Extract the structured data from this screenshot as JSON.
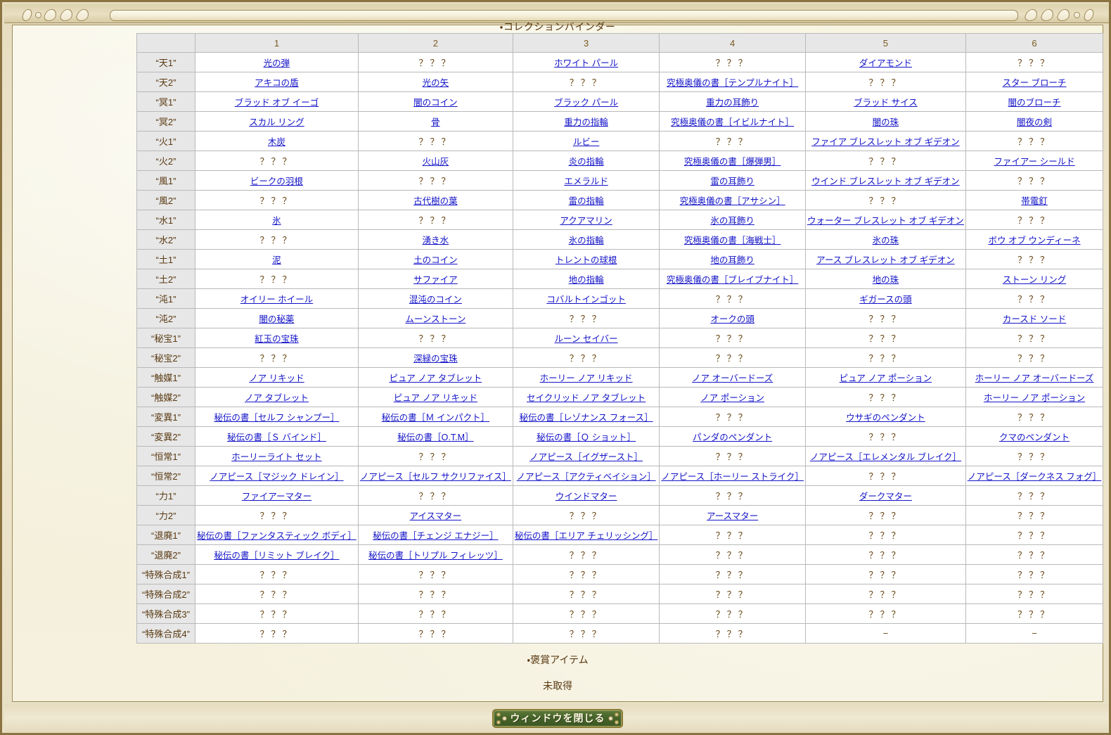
{
  "window": {
    "title": "・コレクションバインダー"
  },
  "table": {
    "corner_label": "",
    "columns": [
      "1",
      "2",
      "3",
      "4",
      "5",
      "6"
    ],
    "unknown_marker": "？？？",
    "dash_marker": "−",
    "rows": [
      {
        "label": "“天1”",
        "cells": [
          "光の弾",
          "？？？",
          "ホワイト パール",
          "？？？",
          "ダイアモンド",
          "？？？"
        ]
      },
      {
        "label": "“天2”",
        "cells": [
          "アキコの盾",
          "光の矢",
          "？？？",
          "究極奥儀の書［テンプルナイト］",
          "？？？",
          "スター ブローチ"
        ]
      },
      {
        "label": "“冥1”",
        "cells": [
          "ブラッド オブ イーゴ",
          "闇のコイン",
          "ブラック パール",
          "重力の耳飾り",
          "ブラッド サイス",
          "闇のブローチ"
        ]
      },
      {
        "label": "“冥2”",
        "cells": [
          "スカル リング",
          "骨",
          "重力の指輪",
          "究極奥儀の書［イビルナイト］",
          "闇の珠",
          "闇夜の剣"
        ]
      },
      {
        "label": "“火1”",
        "cells": [
          "木炭",
          "？？？",
          "ルビー",
          "？？？",
          "ファイア ブレスレット オブ ギデオン",
          "？？？"
        ]
      },
      {
        "label": "“火2”",
        "cells": [
          "？？？",
          "火山灰",
          "炎の指輪",
          "究極奥儀の書［爆弾男］",
          "？？？",
          "ファイアー シールド"
        ]
      },
      {
        "label": "“風1”",
        "cells": [
          "ビークの羽根",
          "？？？",
          "エメラルド",
          "雷の耳飾り",
          "ウインド ブレスレット オブ ギデオン",
          "？？？"
        ]
      },
      {
        "label": "“風2”",
        "cells": [
          "？？？",
          "古代樹の葉",
          "雷の指輪",
          "究極奥儀の書［アサシン］",
          "？？？",
          "帯電釘"
        ]
      },
      {
        "label": "“水1”",
        "cells": [
          "氷",
          "？？？",
          "アクアマリン",
          "氷の耳飾り",
          "ウォーター ブレスレット オブ ギデオン",
          "？？？"
        ]
      },
      {
        "label": "“水2”",
        "cells": [
          "？？？",
          "湧き水",
          "氷の指輪",
          "究極奥儀の書［海戦士］",
          "氷の珠",
          "ボウ オブ ウンディーネ"
        ]
      },
      {
        "label": "“土1”",
        "cells": [
          "泥",
          "土のコイン",
          "トレントの球根",
          "地の耳飾り",
          "アース ブレスレット オブ ギデオン",
          "？？？"
        ]
      },
      {
        "label": "“土2”",
        "cells": [
          "？？？",
          "サファイア",
          "地の指輪",
          "究極奥儀の書［ブレイブナイト］",
          "地の珠",
          "ストーン リング"
        ]
      },
      {
        "label": "“沌1”",
        "cells": [
          "オイリー ホイール",
          "混沌のコイン",
          "コバルトインゴット",
          "？？？",
          "ギガースの頭",
          "？？？"
        ]
      },
      {
        "label": "“沌2”",
        "cells": [
          "闇の秘薬",
          "ムーンストーン",
          "？？？",
          "オークの頭",
          "？？？",
          "カースド ソード"
        ]
      },
      {
        "label": "“秘宝1”",
        "cells": [
          "紅玉の宝珠",
          "？？？",
          "ルーン セイバー",
          "？？？",
          "？？？",
          "？？？"
        ]
      },
      {
        "label": "“秘宝2”",
        "cells": [
          "？？？",
          "深緑の宝珠",
          "？？？",
          "？？？",
          "？？？",
          "？？？"
        ]
      },
      {
        "label": "“触媒1”",
        "cells": [
          "ノア リキッド",
          "ピュア ノア タブレット",
          "ホーリー ノア リキッド",
          "ノア オーバードーズ",
          "ピュア ノア ポーション",
          "ホーリー ノア オーバードーズ"
        ]
      },
      {
        "label": "“触媒2”",
        "cells": [
          "ノア タブレット",
          "ピュア ノア リキッド",
          "セイクリッド ノア タブレット",
          "ノア ポーション",
          "？？？",
          "ホーリー ノア ポーション"
        ]
      },
      {
        "label": "“変異1”",
        "cells": [
          "秘伝の書［セルフ シャンプー］",
          "秘伝の書［Ｍ インパクト］",
          "秘伝の書［レゾナンス フォース］",
          "？？？",
          "ウサギのペンダント",
          "？？？"
        ]
      },
      {
        "label": "“変異2”",
        "cells": [
          "秘伝の書［Ｓ バインド］",
          "秘伝の書［O.T.M］",
          "秘伝の書［Ｑ ショット］",
          "パンダのペンダント",
          "？？？",
          "クマのペンダント"
        ]
      },
      {
        "label": "“恒常1”",
        "cells": [
          "ホーリーライト セット",
          "？？？",
          "ノアピース［イグザースト］",
          "？？？",
          "ノアピース［エレメンタル ブレイク］",
          "？？？"
        ]
      },
      {
        "label": "“恒常2”",
        "cells": [
          "ノアピース［マジック ドレイン］",
          "ノアピース［セルフ サクリファイス］",
          "ノアピース［アクティベイション］",
          "ノアピース［ホーリー ストライク］",
          "？？？",
          "ノアピース［ダークネス フォグ］"
        ]
      },
      {
        "label": "“力1”",
        "cells": [
          "ファイアーマター",
          "？？？",
          "ウインドマター",
          "？？？",
          "ダークマター",
          "？？？"
        ]
      },
      {
        "label": "“力2”",
        "cells": [
          "？？？",
          "アイスマター",
          "？？？",
          "アースマター",
          "？？？",
          "？？？"
        ]
      },
      {
        "label": "“退廃1”",
        "cells": [
          "秘伝の書［ファンタスティック ボディ］",
          "秘伝の書［チェンジ エナジー］",
          "秘伝の書［エリア チェリッシング］",
          "？？？",
          "？？？",
          "？？？"
        ]
      },
      {
        "label": "“退廃2”",
        "cells": [
          "秘伝の書［リミット ブレイク］",
          "秘伝の書［トリプル フィレッツ］",
          "？？？",
          "？？？",
          "？？？",
          "？？？"
        ]
      },
      {
        "label": "“特殊合成1”",
        "cells": [
          "？？？",
          "？？？",
          "？？？",
          "？？？",
          "？？？",
          "？？？"
        ]
      },
      {
        "label": "“特殊合成2”",
        "cells": [
          "？？？",
          "？？？",
          "？？？",
          "？？？",
          "？？？",
          "？？？"
        ]
      },
      {
        "label": "“特殊合成3”",
        "cells": [
          "？？？",
          "？？？",
          "？？？",
          "？？？",
          "？？？",
          "？？？"
        ]
      },
      {
        "label": "“特殊合成4”",
        "cells": [
          "？？？",
          "？？？",
          "？？？",
          "？？？",
          "−",
          "−"
        ]
      }
    ]
  },
  "reward": {
    "title": "・褒賞アイテム",
    "status": "未取得"
  },
  "footer": {
    "close_label": "ウィンドウを閉じる"
  },
  "colors": {
    "link": "#1414c8",
    "text_brown": "#5a3a12",
    "parchment": "#f5f1de",
    "header_gray": "#e7e7e7",
    "button_green": "#46632a"
  }
}
